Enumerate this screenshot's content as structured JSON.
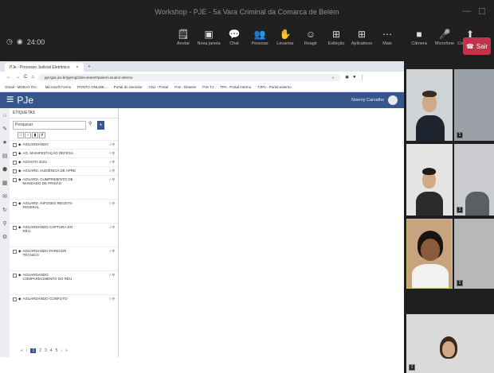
{
  "meeting": {
    "title": "Workshop - PJE - 5a Vara Criminal da Comarca de Belém",
    "timer": "24:00",
    "leave_label": "Sair",
    "win_minimize": "—",
    "win_maximize": "☐",
    "toolbar": [
      {
        "icon": "notes-icon",
        "glyph": "🗒",
        "label": "Anotar"
      },
      {
        "icon": "new-window-icon",
        "glyph": "▣",
        "label": "Nova janela"
      },
      {
        "icon": "chat-icon",
        "glyph": "💬",
        "label": "Chat"
      },
      {
        "icon": "people-icon",
        "glyph": "👥",
        "label": "Pessoas"
      },
      {
        "icon": "raise-hand-icon",
        "glyph": "✋",
        "label": "Levantar"
      },
      {
        "icon": "react-icon",
        "glyph": "☺",
        "label": "Reagir"
      },
      {
        "icon": "rooms-icon",
        "glyph": "⊞",
        "label": "Exibição"
      },
      {
        "icon": "apps-icon",
        "glyph": "⊞",
        "label": "Aplicativos"
      },
      {
        "icon": "more-icon",
        "glyph": "⋯",
        "label": "Mais"
      },
      {
        "icon": "camera-icon",
        "glyph": "■",
        "label": "Câmera"
      },
      {
        "icon": "mic-off-icon",
        "glyph": "🎤",
        "label": "Microfone"
      },
      {
        "icon": "share-icon",
        "glyph": "⬆",
        "label": "Compartilhar"
      }
    ]
  },
  "browser": {
    "tab_title": "PJe - Processo Judicial Eletrônico",
    "tab_close": "×",
    "new_tab": "+",
    "url": "pje.tjpa.jus.br/pje/ng2/dev.seam#/painel-usuario-interno",
    "bookmarks": [
      "Gmail - MODAY DV...",
      "Microsoft Forms",
      "PONTO ONLINE...",
      "Portal do Servidor",
      "CNJ - Portal",
      "PJe - Desenv",
      "PJe TJ",
      "TPA - Portal Interno",
      "TJPA - Portal externo"
    ]
  },
  "pje": {
    "logo": "PJe",
    "user_name": "Noemy Carvalho",
    "panel_title": "ETIQUETAS",
    "search_placeholder": "Pesquisar",
    "filters": [
      "☆",
      "☆",
      "▮",
      "✗"
    ],
    "tags": [
      "AGUARDANDO",
      "AG. MANIFESTAÇÃO DEFESA",
      "AGOSTO 2022",
      "AGUARD. AUDIÊNCIA DE APRE",
      "AGUARD. CUMPRIMENTO DE MANDADO DE PRISÃO",
      "AGUARD. INFOSEG RECEITA FEDERAL",
      "AGUARDANDO CAPTURA DO RÉU",
      "AGUARDANDO PARECER TÉCNICO",
      "AGUARDANDO COMPARECIMENTO DO RÉU",
      "AGUARDANDO CONFLITO"
    ],
    "pager": [
      "«",
      "‹",
      "1",
      "2",
      "3",
      "4",
      "5",
      "›",
      "»"
    ],
    "pager_active": "1"
  },
  "participants": {
    "tile_marks": [
      "1",
      "1",
      "1",
      "1"
    ]
  }
}
